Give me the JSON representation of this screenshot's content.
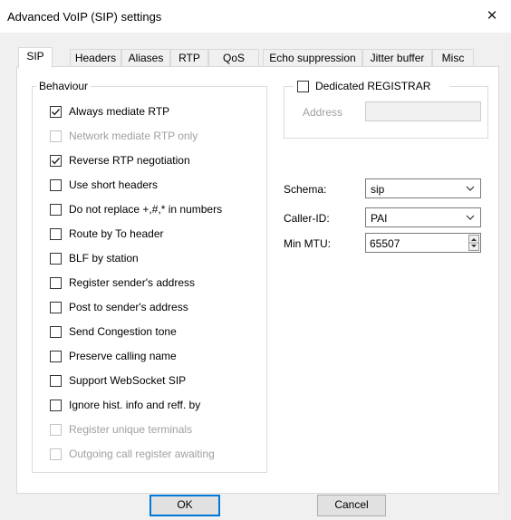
{
  "window": {
    "title": "Advanced VoIP (SIP) settings"
  },
  "tabs": [
    {
      "label": "SIP"
    },
    {
      "label": "Headers"
    },
    {
      "label": "Aliases"
    },
    {
      "label": "RTP"
    },
    {
      "label": "QoS"
    },
    {
      "label": "Echo suppression"
    },
    {
      "label": "Jitter buffer"
    },
    {
      "label": "Misc"
    }
  ],
  "behaviour": {
    "label": "Behaviour",
    "items": [
      {
        "label": "Always mediate RTP",
        "checked": true,
        "enabled": true
      },
      {
        "label": "Network mediate RTP only",
        "checked": false,
        "enabled": false
      },
      {
        "label": "Reverse RTP negotiation",
        "checked": true,
        "enabled": true
      },
      {
        "label": "Use short headers",
        "checked": false,
        "enabled": true
      },
      {
        "label": "Do not replace +,#,* in numbers",
        "checked": false,
        "enabled": true
      },
      {
        "label": "Route by To header",
        "checked": false,
        "enabled": true
      },
      {
        "label": "BLF by station",
        "checked": false,
        "enabled": true
      },
      {
        "label": "Register sender's address",
        "checked": false,
        "enabled": true
      },
      {
        "label": "Post to sender's address",
        "checked": false,
        "enabled": true
      },
      {
        "label": "Send Congestion tone",
        "checked": false,
        "enabled": true
      },
      {
        "label": "Preserve calling name",
        "checked": false,
        "enabled": true
      },
      {
        "label": "Support WebSocket SIP",
        "checked": false,
        "enabled": true
      },
      {
        "label": "Ignore hist. info and reff. by",
        "checked": false,
        "enabled": true
      },
      {
        "label": "Register unique terminals",
        "checked": false,
        "enabled": false
      },
      {
        "label": "Outgoing call register awaiting",
        "checked": false,
        "enabled": false
      }
    ]
  },
  "registrar": {
    "label": "Dedicated REGISTRAR",
    "checked": false,
    "address_label": "Address",
    "address_value": ""
  },
  "fields": {
    "schema_label": "Schema:",
    "schema_value": "sip",
    "callerid_label": "Caller-ID:",
    "callerid_value": "PAI",
    "minmtu_label": "Min MTU:",
    "minmtu_value": "65507"
  },
  "buttons": {
    "ok": "OK",
    "cancel": "Cancel"
  },
  "colors": {
    "accent": "#0078d7"
  }
}
